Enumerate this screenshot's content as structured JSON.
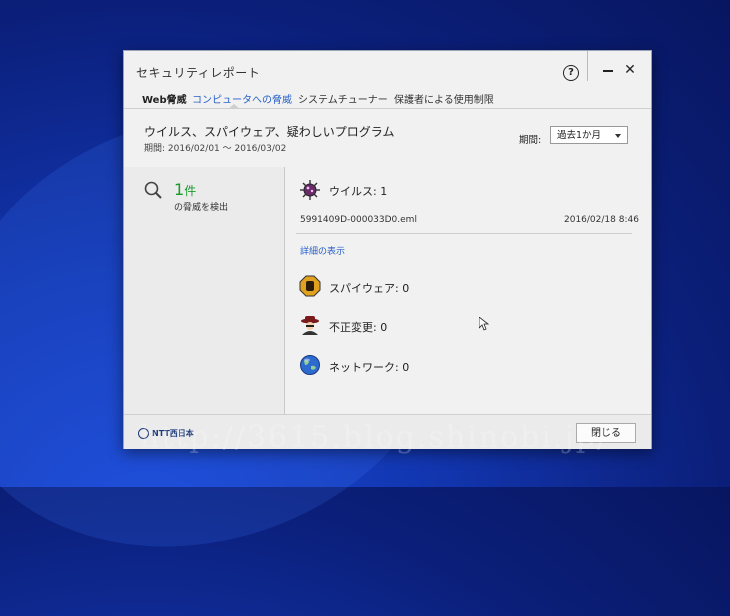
{
  "window": {
    "title": "セキュリティレポート"
  },
  "tabs": [
    {
      "label": "Web脅威"
    },
    {
      "label": "コンピュータへの脅威"
    },
    {
      "label": "システムチューナー"
    },
    {
      "label": "保護者による使用制限"
    }
  ],
  "report": {
    "title": "ウイルス、スパイウェア、疑わしいプログラム",
    "period_text": "期間: 2016/02/01 ～ 2016/03/02",
    "period_label": "期間:",
    "period_selected": "過去1か月"
  },
  "summary": {
    "count": "1",
    "count_unit": "件",
    "label": "の脅威を検出"
  },
  "threats": {
    "virus": {
      "label": "ウイルス: 1",
      "file": "5991409D-000033D0.eml",
      "time": "2016/02/18 8:46",
      "details_link": "詳細の表示"
    },
    "spyware": {
      "label": "スパイウェア: 0"
    },
    "unauthorized": {
      "label": "不正変更: 0"
    },
    "network": {
      "label": "ネットワーク: 0"
    }
  },
  "footer": {
    "logo": "NTT西日本",
    "close_label": "閉じる"
  },
  "watermark": "http://3615.blog.shinobi.jp/",
  "colors": {
    "accent": "#2860c8",
    "count_green": "#1a9a2c",
    "wallpaper": "#1236b0"
  }
}
